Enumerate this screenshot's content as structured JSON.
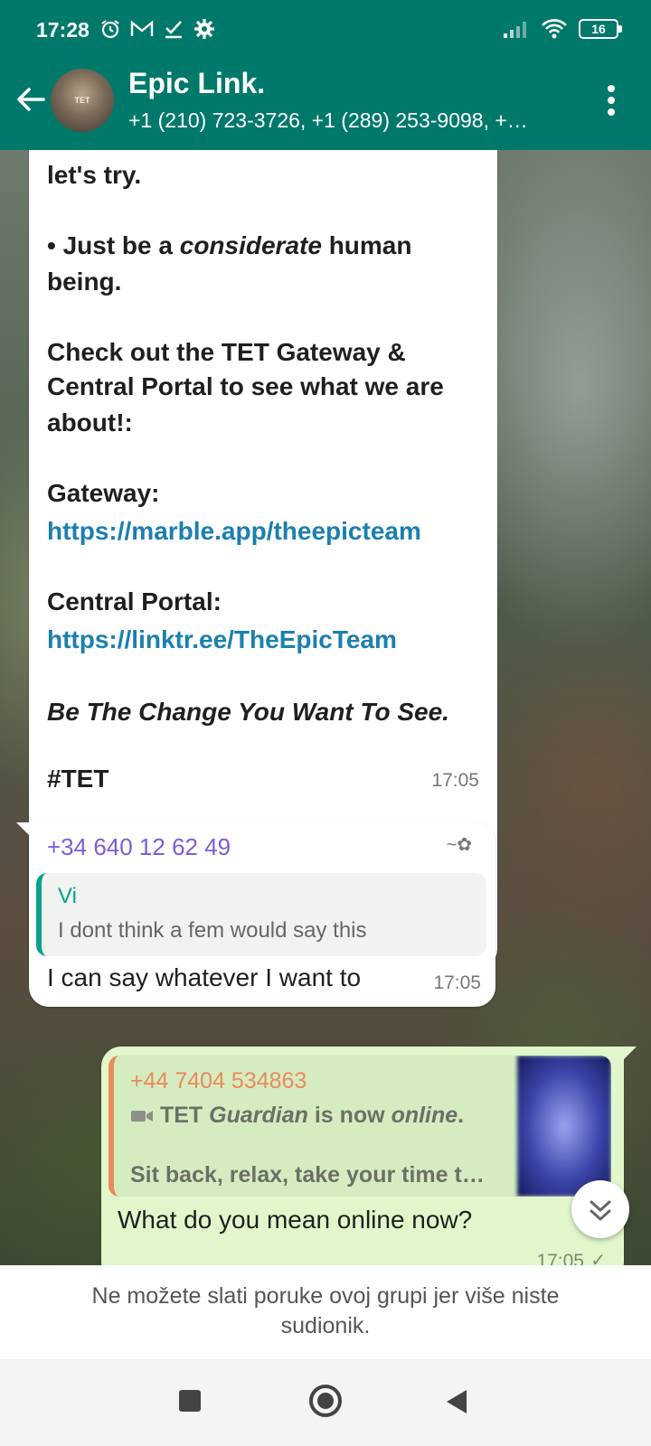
{
  "status_bar": {
    "time": "17:28",
    "battery": "16",
    "icons": [
      "alarm-icon",
      "gmail-icon",
      "task-icon",
      "settings-gear-icon",
      "signal-icon",
      "wifi-icon",
      "battery-icon"
    ]
  },
  "app_bar": {
    "title": "Epic Link.",
    "subtitle": "+1 (210) 723-3726, +1 (289) 253-9098, +…",
    "avatar_text": "TET"
  },
  "messages": {
    "m1": {
      "line_partial": "let's try.",
      "bullet_prefix": "• Just be a ",
      "bullet_italic": "considerate",
      "bullet_suffix": " human",
      "bullet_line2": "being.",
      "check_1": "Check out the TET Gateway &",
      "check_2": "Central Portal to see what we are",
      "check_3": "about!:",
      "gateway_label": "Gateway:",
      "gateway_link": "https://marble.app/theepicteam",
      "portal_label": "Central Portal:",
      "portal_link": "https://linktr.ee/TheEpicTeam",
      "motto": "Be The Change You Want To See.",
      "hashtag": "#TET",
      "time": "17:05"
    },
    "m2": {
      "sender": "+34 640 12 62 49",
      "sender_badge": "~✿",
      "quote_name": "Vi",
      "quote_text": "I dont think a fem would say this",
      "body": "I can say whatever I want to",
      "time": "17:05"
    },
    "m3": {
      "quote_name": "+44 7404 534863",
      "quote_line1_a": "TET ",
      "quote_line1_b": "Guardian",
      "quote_line1_c": " is now ",
      "quote_line1_d": "online",
      "quote_line1_e": ".",
      "quote_line2": "Sit back, relax, take your time t…",
      "body": "What do you mean online now?",
      "time": "17:05"
    }
  },
  "notice": "Ne možete slati poruke ovoj grupi jer više niste sudionik.",
  "colors": {
    "header": "#00796b",
    "link": "#1b7fb0",
    "sender_m2": "#7e5bd8",
    "quote_vi": "#06a48a",
    "quote_m3": "#e98a5b",
    "outgoing_bubble": "#e1f7cb"
  }
}
